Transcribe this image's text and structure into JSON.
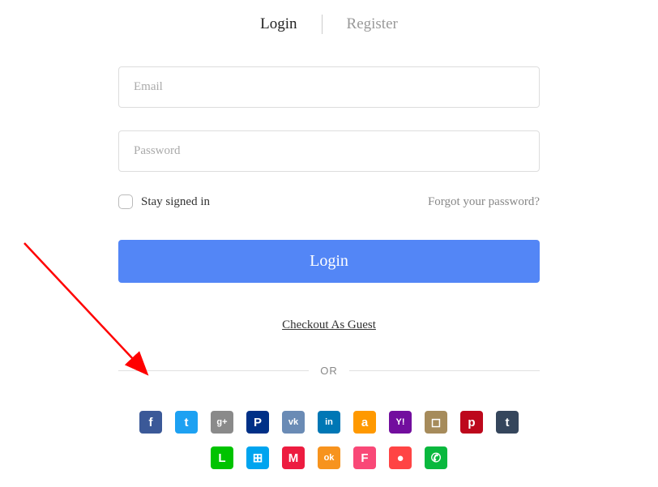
{
  "tabs": {
    "login": "Login",
    "register": "Register"
  },
  "form": {
    "emailPlaceholder": "Email",
    "passwordPlaceholder": "Password",
    "staySignedIn": "Stay signed in",
    "forgotPassword": "Forgot your password?",
    "loginButton": "Login",
    "guestCheckout": "Checkout As Guest",
    "orText": "OR"
  },
  "social": [
    {
      "name": "facebook",
      "bg": "#3b5998",
      "glyph": "f"
    },
    {
      "name": "twitter",
      "bg": "#1da1f2",
      "glyph": "t"
    },
    {
      "name": "google-plus",
      "bg": "#8a8a8a",
      "glyph": "g+"
    },
    {
      "name": "paypal",
      "bg": "#003087",
      "glyph": "P"
    },
    {
      "name": "vk",
      "bg": "#6a8bb5",
      "glyph": "vk"
    },
    {
      "name": "linkedin",
      "bg": "#0077b5",
      "glyph": "in"
    },
    {
      "name": "amazon",
      "bg": "#ff9900",
      "glyph": "a"
    },
    {
      "name": "yahoo",
      "bg": "#720e9e",
      "glyph": "Y!"
    },
    {
      "name": "instagram",
      "bg": "#a68b5b",
      "glyph": "◻"
    },
    {
      "name": "pinterest",
      "bg": "#bd081c",
      "glyph": "p"
    },
    {
      "name": "tumblr",
      "bg": "#35465c",
      "glyph": "t"
    },
    {
      "name": "line",
      "bg": "#00c300",
      "glyph": "L"
    },
    {
      "name": "windows",
      "bg": "#00a4ef",
      "glyph": "⊞"
    },
    {
      "name": "meetup",
      "bg": "#ed1c40",
      "glyph": "M"
    },
    {
      "name": "odnoklassniki",
      "bg": "#f7931e",
      "glyph": "ok"
    },
    {
      "name": "foursquare",
      "bg": "#f94877",
      "glyph": "F"
    },
    {
      "name": "qq",
      "bg": "#ff4444",
      "glyph": "●"
    },
    {
      "name": "wechat",
      "bg": "#09b83e",
      "glyph": "✆"
    }
  ]
}
